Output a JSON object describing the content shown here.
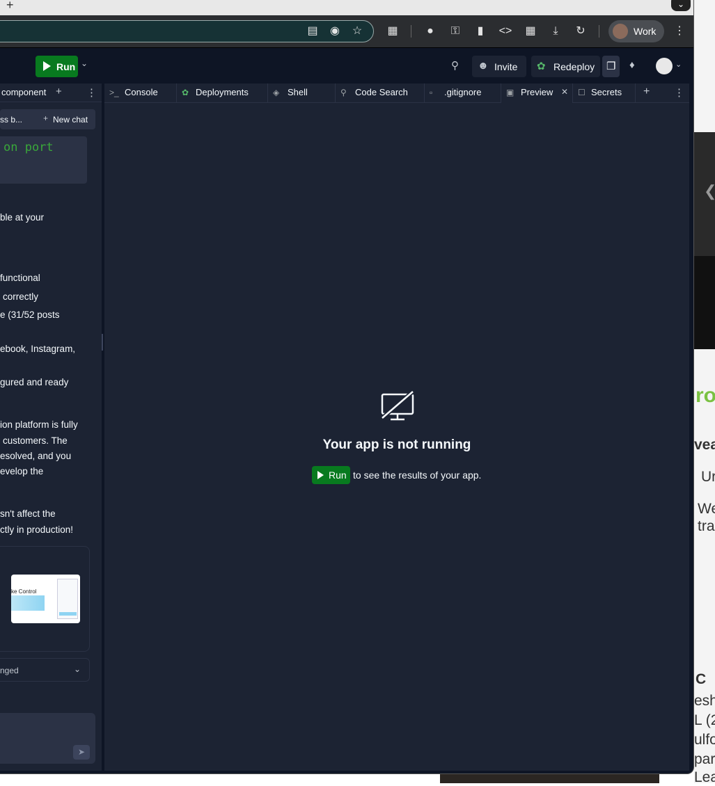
{
  "browser": {
    "profile_label": "Work",
    "new_tab_icon": "plus-icon",
    "toolbar_icons": [
      "install-icon",
      "eye-off-icon",
      "star-icon",
      "extensions-icon",
      "incognito-icon",
      "key-icon",
      "trash-icon",
      "code-icon",
      "table-icon",
      "download-icon",
      "history-icon",
      "more-vert-icon"
    ]
  },
  "header": {
    "run_label": "Run",
    "invite_label": "Invite",
    "redeploy_label": "Redeploy"
  },
  "left_pane": {
    "tab_label": "component",
    "chat_title": "ss b...",
    "new_chat_label": "New chat",
    "code_text": "on port",
    "lines": [
      "ble at your",
      "functional",
      "correctly",
      "e (31/52 posts",
      "ebook, Instagram,",
      "gured and ready",
      "ion platform is fully",
      "customers. The",
      "esolved, and you",
      "evelop the",
      "sn't affect the",
      "ctly in production!"
    ],
    "thumbnail_text": "ke Control",
    "changed_label": "nged"
  },
  "right_pane": {
    "tabs": [
      {
        "label": "Console",
        "icon": "terminal-icon"
      },
      {
        "label": "Deployments",
        "icon": "deploy-icon"
      },
      {
        "label": "Shell",
        "icon": "shell-icon"
      },
      {
        "label": "Code Search",
        "icon": "search-icon"
      },
      {
        "label": ".gitignore",
        "icon": "file-icon"
      },
      {
        "label": "Preview",
        "icon": "monitor-icon"
      },
      {
        "label": "Secrets",
        "icon": "lock-icon"
      }
    ],
    "active_tab": "Preview",
    "status_title": "Your app is not running",
    "hint_run_label": "Run",
    "hint_text": "to see the results of your app."
  },
  "background": {
    "frag_1": "ro",
    "frag_2": "vea",
    "frag_3": "Ur",
    "frag_4": "We",
    "frag_5": "tra",
    "frag_6": "C",
    "frag_7": "esh",
    "frag_8": "L (2",
    "frag_9": "ulfo",
    "frag_10": "par",
    "frag_11": "Leav"
  },
  "colors": {
    "run_green": "#087a1f",
    "pane_bg": "#1c2333",
    "app_bg": "#0e1525"
  }
}
